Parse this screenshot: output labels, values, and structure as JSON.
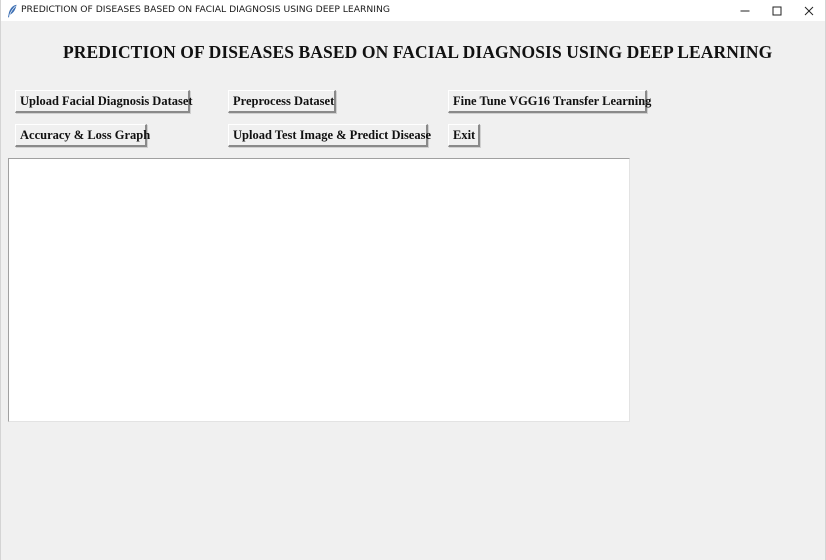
{
  "window": {
    "title": "PREDICTION OF DISEASES BASED ON FACIAL DIAGNOSIS USING DEEP LEARNING",
    "icon": "feather-icon",
    "controls": [
      "minimize-icon",
      "maximize-icon",
      "close-icon"
    ]
  },
  "header": {
    "title": "PREDICTION OF DISEASES BASED ON FACIAL DIAGNOSIS USING DEEP LEARNING"
  },
  "buttons": {
    "upload_dataset": "Upload Facial Diagnosis Dataset",
    "preprocess": "Preprocess Dataset",
    "finetune": "Fine Tune VGG16 Transfer Learning",
    "accuracy_graph": "Accuracy & Loss Graph",
    "upload_test": "Upload Test Image & Predict Disease",
    "exit": "Exit"
  },
  "output": {
    "text": ""
  },
  "colors": {
    "window_background": "#f0f0f0",
    "titlebar_background": "#ffffff",
    "text_area_background": "#ffffff"
  }
}
